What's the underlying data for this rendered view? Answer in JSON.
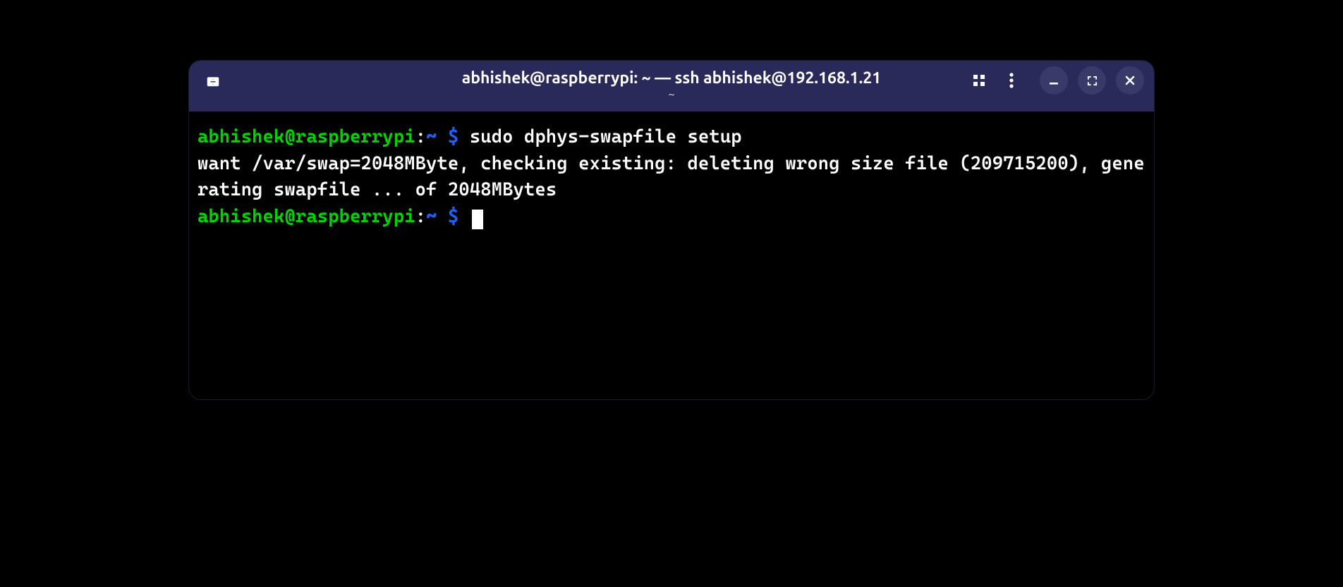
{
  "window": {
    "title": "abhishek@raspberrypi: ~ — ssh abhishek@192.168.1.21",
    "subtitle": "~"
  },
  "prompt1": {
    "userhost": "abhishek@raspberrypi",
    "colon": ":",
    "cwd": "~ ",
    "dollar": "$",
    "space": " ",
    "command": "sudo dphys-swapfile setup"
  },
  "output": {
    "line1": "want /var/swap=2048MByte, checking existing: deleting wrong size file (209715200), generating swapfile ... of 2048MBytes"
  },
  "prompt2": {
    "userhost": "abhishek@raspberrypi",
    "colon": ":",
    "cwd": "~ ",
    "dollar": "$",
    "space": " "
  }
}
